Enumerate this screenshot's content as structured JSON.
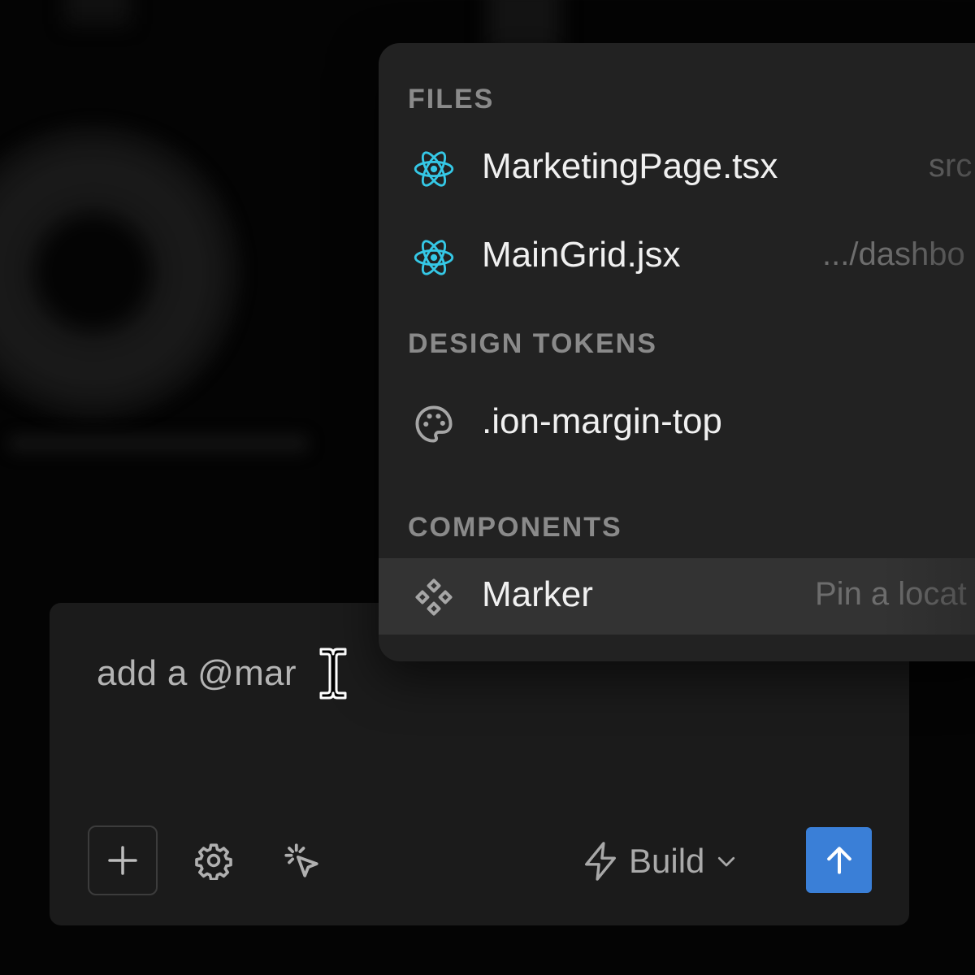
{
  "composer": {
    "prompt_text": "add a @mar",
    "mode": {
      "label": "Build",
      "icon": "lightning-icon"
    },
    "tools": [
      {
        "name": "add-icon"
      },
      {
        "name": "gear-icon"
      },
      {
        "name": "select-cursor-icon"
      }
    ],
    "send_icon": "arrow-up-icon",
    "accent_color": "#3a7fd7"
  },
  "popover": {
    "sections": {
      "files": {
        "title": "FILES",
        "items": [
          {
            "label": "MarketingPage.tsx",
            "meta": "src",
            "icon": "react-icon"
          },
          {
            "label": "MainGrid.jsx",
            "meta": ".../dashbo",
            "icon": "react-icon"
          }
        ]
      },
      "design_tokens": {
        "title": "DESIGN TOKENS",
        "items": [
          {
            "label": ".ion-margin-top",
            "icon": "palette-icon"
          }
        ]
      },
      "components": {
        "title": "COMPONENTS",
        "items": [
          {
            "label": "Marker",
            "meta": "Pin a locat",
            "icon": "component-icon"
          }
        ]
      }
    },
    "react_color": "#35c8e6"
  }
}
